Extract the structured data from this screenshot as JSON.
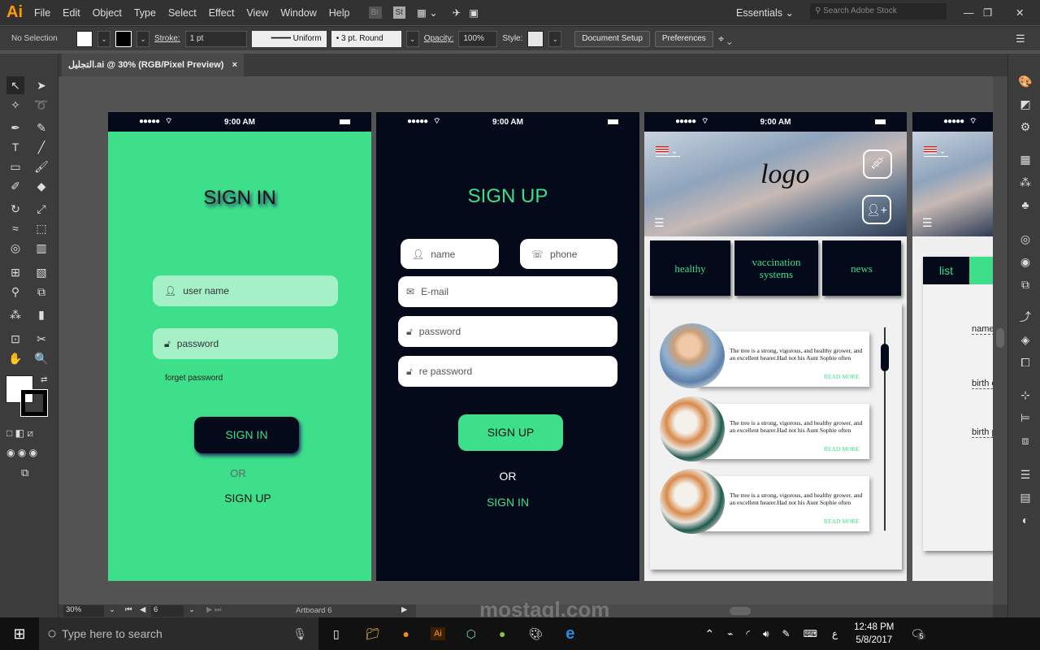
{
  "app": {
    "logo": "Ai",
    "menu": [
      "File",
      "Edit",
      "Object",
      "Type",
      "Select",
      "Effect",
      "View",
      "Window",
      "Help"
    ],
    "bridge": "Br",
    "stock": "St",
    "workspace": "Essentials",
    "search_placeholder": "Search Adobe Stock"
  },
  "control": {
    "selection": "No Selection",
    "stroke_label": "Stroke:",
    "stroke_value": "1 pt",
    "profile": "Uniform",
    "brush": "3 pt. Round",
    "opacity_label": "Opacity:",
    "opacity_value": "100%",
    "style_label": "Style:",
    "document_setup": "Document Setup",
    "preferences": "Preferences"
  },
  "document": {
    "tab": "التجليل.ai @ 30% (RGB/Pixel Preview)",
    "close": "×"
  },
  "statusbar": {
    "zoom": "30%",
    "artboard_number": "6",
    "artboard_name": "Artboard 6"
  },
  "phone": {
    "time": "9:00 AM",
    "signal": "●●●●●"
  },
  "signin": {
    "title": "SIGN IN",
    "username": "user name",
    "password": "password",
    "forgot": "forget password",
    "button": "SIGN IN",
    "or": "OR",
    "signup": "SIGN UP",
    "color": "#3ddf8b"
  },
  "signup": {
    "title": "SIGN UP",
    "name": "name",
    "phone": "phone",
    "email": "E-mail",
    "password": "password",
    "repassword": "re password",
    "button": "SIGN UP",
    "or": "OR",
    "signin": "SIGN IN",
    "bg": "#040a1a"
  },
  "home": {
    "logo": "logo",
    "categories": [
      "healthy",
      "vaccination systems",
      "news"
    ],
    "cards": [
      {
        "text": "The tree is a strong, vigorous, and healthy grower, and an excellent bearer.Had not his Aunt Sophie often",
        "link": "READ MORE"
      },
      {
        "text": "The tree is a strong, vigorous, and healthy grower, and an excellent bearer.Had not his Aunt Sophie often",
        "link": "READ MORE"
      },
      {
        "text": "The tree is a strong, vigorous, and healthy grower, and an excellent bearer.Had not his Aunt Sophie often",
        "link": "READ MORE"
      }
    ]
  },
  "profile": {
    "tab": "list",
    "fields": [
      "name",
      "birth d",
      "birth p"
    ]
  },
  "taskbar": {
    "search": "Type here to search",
    "time": "12:48 PM",
    "date": "5/8/2017",
    "lang": "ع",
    "notifications": "5"
  },
  "watermark": "mostaql.com"
}
